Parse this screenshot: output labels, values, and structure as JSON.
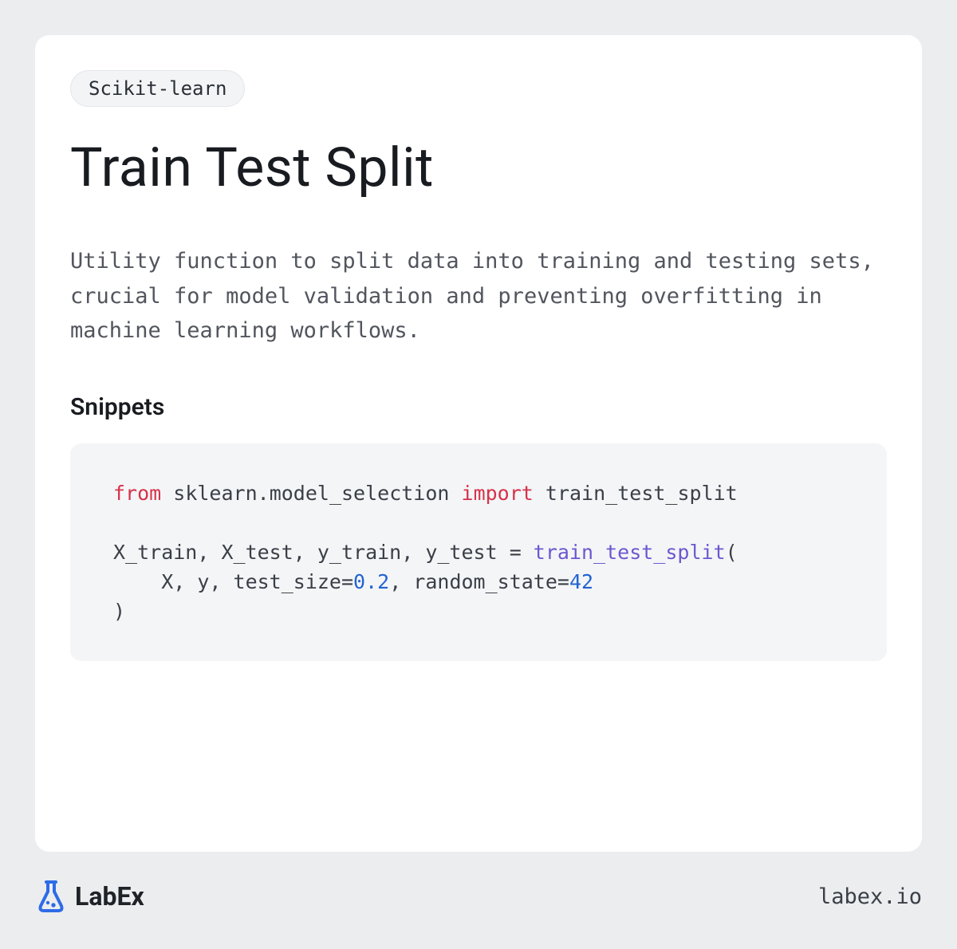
{
  "tag": "Scikit-learn",
  "title": "Train Test Split",
  "description": "Utility function to split data into training and testing sets, crucial for model validation and preventing overfitting in machine learning workflows.",
  "section_title": "Snippets",
  "code": {
    "from": "from",
    "module": "sklearn.model_selection",
    "import": "import",
    "name": "train_test_split",
    "assign": "X_train, X_test, y_train, y_test = ",
    "func": "train_test_split",
    "open": "(",
    "indent": "    X, y, test_size=",
    "test_size": "0.2",
    "mid": ", random_state=",
    "random_state": "42",
    "close": ")"
  },
  "logo_text": "LabEx",
  "site": "labex.io"
}
